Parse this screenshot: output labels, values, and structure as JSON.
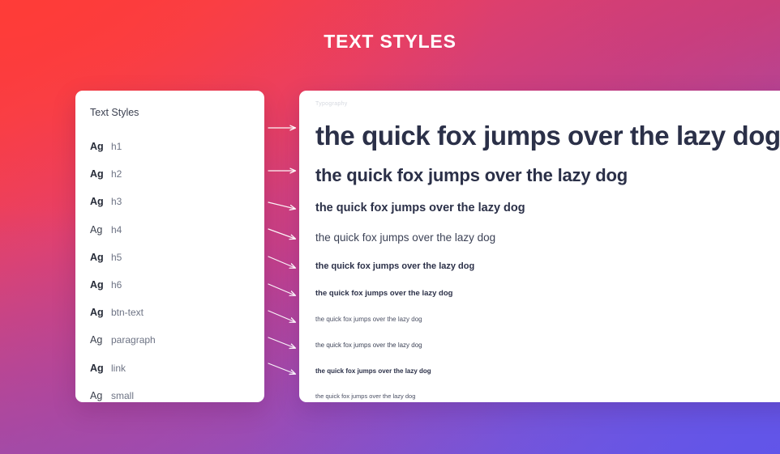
{
  "page": {
    "title": "TEXT STYLES",
    "background_colors": {
      "top_left": "#FB3A3C",
      "top_right": "#D33C66",
      "bottom_left": "#8F51B5",
      "bottom_right": "#6A5AE8"
    },
    "title_color": "#FFFFFF"
  },
  "left_panel": {
    "title": "Text Styles",
    "sample_glyph": "Ag",
    "items": [
      {
        "glyph": "Ag",
        "label": "h1"
      },
      {
        "glyph": "Ag",
        "label": "h2"
      },
      {
        "glyph": "Ag",
        "label": "h3"
      },
      {
        "glyph": "Ag",
        "label": "h4"
      },
      {
        "glyph": "Ag",
        "label": "h5"
      },
      {
        "glyph": "Ag",
        "label": "h6"
      },
      {
        "glyph": "Ag",
        "label": "btn-text"
      },
      {
        "glyph": "Ag",
        "label": "paragraph"
      },
      {
        "glyph": "Ag",
        "label": "link"
      },
      {
        "glyph": "Ag",
        "label": "small"
      }
    ]
  },
  "right_panel": {
    "label": "Typography",
    "specimens": [
      {
        "style": "h1",
        "text": "the quick fox jumps over the lazy dog"
      },
      {
        "style": "h2",
        "text": "the quick fox jumps over the lazy dog"
      },
      {
        "style": "h3",
        "text": "the quick fox jumps over the lazy dog"
      },
      {
        "style": "h4",
        "text": "the quick fox jumps over the lazy dog"
      },
      {
        "style": "h5",
        "text": "the quick fox jumps over the lazy dog"
      },
      {
        "style": "h6",
        "text": "the quick fox jumps over the lazy dog"
      },
      {
        "style": "btn-text",
        "text": "the quick fox jumps over the lazy dog"
      },
      {
        "style": "paragraph",
        "text": "the quick fox jumps over the lazy dog"
      },
      {
        "style": "link",
        "text": "the quick fox jumps over the lazy dog"
      },
      {
        "style": "small",
        "text": "the quick fox jumps over the lazy dog"
      }
    ],
    "text_color": "#2B3048"
  },
  "connectors": {
    "count": 10,
    "color": "#FFFFFF",
    "icon": "arrow-right-icon"
  }
}
